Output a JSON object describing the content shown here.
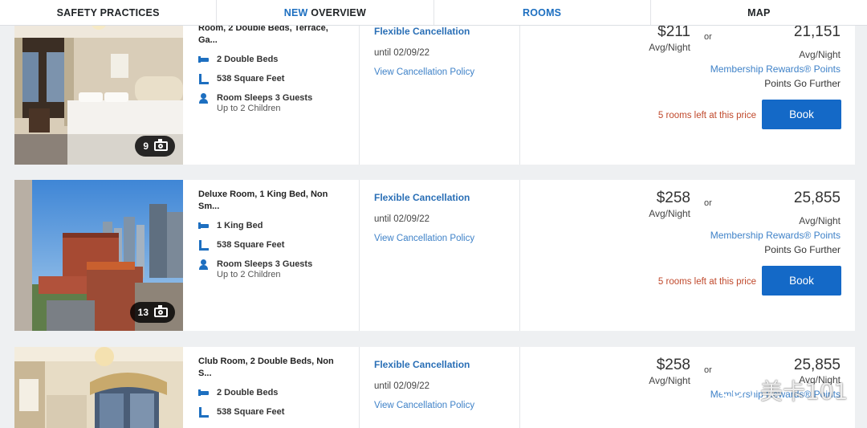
{
  "tabs": {
    "safety": "SAFETY PRACTICES",
    "overview_new": "NEW",
    "overview": "OVERVIEW",
    "rooms": "ROOMS",
    "map": "MAP"
  },
  "labels": {
    "avg_night": "Avg/Night",
    "or": "or",
    "membership_rewards": "Membership Rewards® Points",
    "points_go_further": "Points Go Further",
    "book": "Book",
    "until": "until 02/09/22",
    "flexible_cancellation": "Flexible Cancellation",
    "view_policy": "View Cancellation Policy",
    "rooms_left": "5 rooms left at this price"
  },
  "rooms": [
    {
      "name": "Room, 2 Double Beds, Terrace, Ga...",
      "photo_count": "9",
      "beds": "2 Double Beds",
      "size": "538 Square Feet",
      "sleeps": "Room Sleeps 3 Guests",
      "children": "Up to 2 Children",
      "price": "$211",
      "points": "21,151"
    },
    {
      "name": "Deluxe Room, 1 King Bed, Non Sm...",
      "photo_count": "13",
      "beds": "1 King Bed",
      "size": "538 Square Feet",
      "sleeps": "Room Sleeps 3 Guests",
      "children": "Up to 2 Children",
      "price": "$258",
      "points": "25,855"
    },
    {
      "name": "Club Room, 2 Double Beds, Non S...",
      "beds": "2 Double Beds",
      "size": "538 Square Feet",
      "price": "$258",
      "points": "25,855"
    }
  ],
  "watermark": "美卡101",
  "colors": {
    "accent": "#1469c7",
    "link": "#3f82c8",
    "warning": "#c0492c"
  }
}
